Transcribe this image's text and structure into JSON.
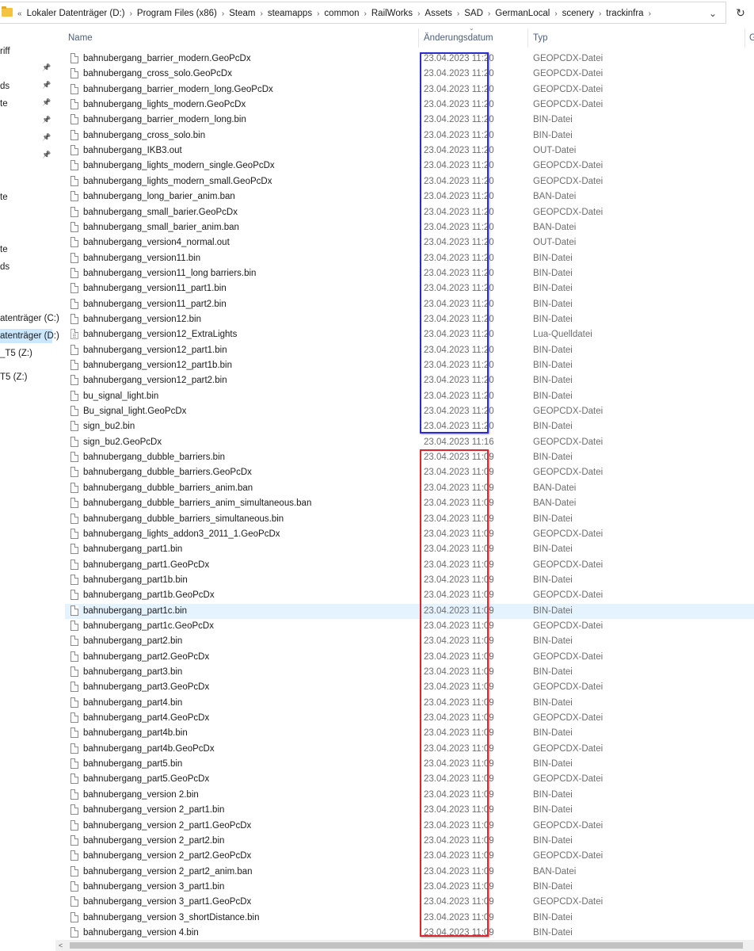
{
  "address": {
    "crumbs": [
      "Lokaler Datenträger (D:)",
      "Program Files (x86)",
      "Steam",
      "steamapps",
      "common",
      "RailWorks",
      "Assets",
      "SAD",
      "GermanLocal",
      "scenery",
      "trackinfra"
    ],
    "prefix": "«"
  },
  "nav": {
    "items": [
      "riff",
      "ds",
      "te",
      "te",
      "te",
      "ds",
      "atenträger (C:)",
      "atenträger (D:)",
      "_T5 (Z:)",
      "T5 (Z:)"
    ]
  },
  "columns": {
    "name": "Name",
    "date": "Änderungsdatum",
    "type": "Typ",
    "extra": "G"
  },
  "files": [
    {
      "name": "bahnubergang_barrier_modern.GeoPcDx",
      "date": "23.04.2023 11:20",
      "type": "GEOPCDX-Datei"
    },
    {
      "name": "bahnubergang_cross_solo.GeoPcDx",
      "date": "23.04.2023 11:20",
      "type": "GEOPCDX-Datei"
    },
    {
      "name": "bahnubergang_barrier_modern_long.GeoPcDx",
      "date": "23.04.2023 11:20",
      "type": "GEOPCDX-Datei"
    },
    {
      "name": "bahnubergang_lights_modern.GeoPcDx",
      "date": "23.04.2023 11:20",
      "type": "GEOPCDX-Datei"
    },
    {
      "name": "bahnubergang_barrier_modern_long.bin",
      "date": "23.04.2023 11:20",
      "type": "BIN-Datei"
    },
    {
      "name": "bahnubergang_cross_solo.bin",
      "date": "23.04.2023 11:20",
      "type": "BIN-Datei"
    },
    {
      "name": "bahnubergang_IKB3.out",
      "date": "23.04.2023 11:20",
      "type": "OUT-Datei"
    },
    {
      "name": "bahnubergang_lights_modern_single.GeoPcDx",
      "date": "23.04.2023 11:20",
      "type": "GEOPCDX-Datei"
    },
    {
      "name": "bahnubergang_lights_modern_small.GeoPcDx",
      "date": "23.04.2023 11:20",
      "type": "GEOPCDX-Datei"
    },
    {
      "name": "bahnubergang_long_barier_anim.ban",
      "date": "23.04.2023 11:20",
      "type": "BAN-Datei"
    },
    {
      "name": "bahnubergang_small_barier.GeoPcDx",
      "date": "23.04.2023 11:20",
      "type": "GEOPCDX-Datei"
    },
    {
      "name": "bahnubergang_small_barier_anim.ban",
      "date": "23.04.2023 11:20",
      "type": "BAN-Datei"
    },
    {
      "name": "bahnubergang_version4_normal.out",
      "date": "23.04.2023 11:20",
      "type": "OUT-Datei"
    },
    {
      "name": "bahnubergang_version11.bin",
      "date": "23.04.2023 11:20",
      "type": "BIN-Datei"
    },
    {
      "name": "bahnubergang_version11_long barriers.bin",
      "date": "23.04.2023 11:20",
      "type": "BIN-Datei"
    },
    {
      "name": "bahnubergang_version11_part1.bin",
      "date": "23.04.2023 11:20",
      "type": "BIN-Datei"
    },
    {
      "name": "bahnubergang_version11_part2.bin",
      "date": "23.04.2023 11:20",
      "type": "BIN-Datei"
    },
    {
      "name": "bahnubergang_version12.bin",
      "date": "23.04.2023 11:20",
      "type": "BIN-Datei"
    },
    {
      "name": "bahnubergang_version12_ExtraLights",
      "date": "23.04.2023 11:20",
      "type": "Lua-Quelldatei",
      "icon": "lua"
    },
    {
      "name": "bahnubergang_version12_part1.bin",
      "date": "23.04.2023 11:20",
      "type": "BIN-Datei"
    },
    {
      "name": "bahnubergang_version12_part1b.bin",
      "date": "23.04.2023 11:20",
      "type": "BIN-Datei"
    },
    {
      "name": "bahnubergang_version12_part2.bin",
      "date": "23.04.2023 11:20",
      "type": "BIN-Datei"
    },
    {
      "name": "bu_signal_light.bin",
      "date": "23.04.2023 11:20",
      "type": "BIN-Datei"
    },
    {
      "name": "Bu_signal_light.GeoPcDx",
      "date": "23.04.2023 11:20",
      "type": "GEOPCDX-Datei"
    },
    {
      "name": "sign_bu2.bin",
      "date": "23.04.2023 11:20",
      "type": "BIN-Datei"
    },
    {
      "name": "sign_bu2.GeoPcDx",
      "date": "23.04.2023 11:16",
      "type": "GEOPCDX-Datei"
    },
    {
      "name": "bahnubergang_dubble_barriers.bin",
      "date": "23.04.2023 11:09",
      "type": "BIN-Datei"
    },
    {
      "name": "bahnubergang_dubble_barriers.GeoPcDx",
      "date": "23.04.2023 11:09",
      "type": "GEOPCDX-Datei"
    },
    {
      "name": "bahnubergang_dubble_barriers_anim.ban",
      "date": "23.04.2023 11:09",
      "type": "BAN-Datei"
    },
    {
      "name": "bahnubergang_dubble_barriers_anim_simultaneous.ban",
      "date": "23.04.2023 11:09",
      "type": "BAN-Datei"
    },
    {
      "name": "bahnubergang_dubble_barriers_simultaneous.bin",
      "date": "23.04.2023 11:09",
      "type": "BIN-Datei"
    },
    {
      "name": "bahnubergang_lights_addon3_2011_1.GeoPcDx",
      "date": "23.04.2023 11:09",
      "type": "GEOPCDX-Datei"
    },
    {
      "name": "bahnubergang_part1.bin",
      "date": "23.04.2023 11:09",
      "type": "BIN-Datei"
    },
    {
      "name": "bahnubergang_part1.GeoPcDx",
      "date": "23.04.2023 11:09",
      "type": "GEOPCDX-Datei"
    },
    {
      "name": "bahnubergang_part1b.bin",
      "date": "23.04.2023 11:09",
      "type": "BIN-Datei"
    },
    {
      "name": "bahnubergang_part1b.GeoPcDx",
      "date": "23.04.2023 11:09",
      "type": "GEOPCDX-Datei"
    },
    {
      "name": "bahnubergang_part1c.bin",
      "date": "23.04.2023 11:09",
      "type": "BIN-Datei",
      "hover": true
    },
    {
      "name": "bahnubergang_part1c.GeoPcDx",
      "date": "23.04.2023 11:09",
      "type": "GEOPCDX-Datei"
    },
    {
      "name": "bahnubergang_part2.bin",
      "date": "23.04.2023 11:09",
      "type": "BIN-Datei"
    },
    {
      "name": "bahnubergang_part2.GeoPcDx",
      "date": "23.04.2023 11:09",
      "type": "GEOPCDX-Datei"
    },
    {
      "name": "bahnubergang_part3.bin",
      "date": "23.04.2023 11:09",
      "type": "BIN-Datei"
    },
    {
      "name": "bahnubergang_part3.GeoPcDx",
      "date": "23.04.2023 11:09",
      "type": "GEOPCDX-Datei"
    },
    {
      "name": "bahnubergang_part4.bin",
      "date": "23.04.2023 11:09",
      "type": "BIN-Datei"
    },
    {
      "name": "bahnubergang_part4.GeoPcDx",
      "date": "23.04.2023 11:09",
      "type": "GEOPCDX-Datei"
    },
    {
      "name": "bahnubergang_part4b.bin",
      "date": "23.04.2023 11:09",
      "type": "BIN-Datei"
    },
    {
      "name": "bahnubergang_part4b.GeoPcDx",
      "date": "23.04.2023 11:09",
      "type": "GEOPCDX-Datei"
    },
    {
      "name": "bahnubergang_part5.bin",
      "date": "23.04.2023 11:09",
      "type": "BIN-Datei"
    },
    {
      "name": "bahnubergang_part5.GeoPcDx",
      "date": "23.04.2023 11:09",
      "type": "GEOPCDX-Datei"
    },
    {
      "name": "bahnubergang_version 2.bin",
      "date": "23.04.2023 11:09",
      "type": "BIN-Datei"
    },
    {
      "name": "bahnubergang_version 2_part1.bin",
      "date": "23.04.2023 11:09",
      "type": "BIN-Datei"
    },
    {
      "name": "bahnubergang_version 2_part1.GeoPcDx",
      "date": "23.04.2023 11:09",
      "type": "GEOPCDX-Datei"
    },
    {
      "name": "bahnubergang_version 2_part2.bin",
      "date": "23.04.2023 11:09",
      "type": "BIN-Datei"
    },
    {
      "name": "bahnubergang_version 2_part2.GeoPcDx",
      "date": "23.04.2023 11:09",
      "type": "GEOPCDX-Datei"
    },
    {
      "name": "bahnubergang_version 2_part2_anim.ban",
      "date": "23.04.2023 11:09",
      "type": "BAN-Datei"
    },
    {
      "name": "bahnubergang_version 3_part1.bin",
      "date": "23.04.2023 11:09",
      "type": "BIN-Datei"
    },
    {
      "name": "bahnubergang_version 3_part1.GeoPcDx",
      "date": "23.04.2023 11:09",
      "type": "GEOPCDX-Datei"
    },
    {
      "name": "bahnubergang_version 3_shortDistance.bin",
      "date": "23.04.2023 11:09",
      "type": "BIN-Datei"
    },
    {
      "name": "bahnubergang_version 4.bin",
      "date": "23.04.2023 11:09",
      "type": "BIN-Datei"
    }
  ],
  "colors": {
    "highlight_blue": "#2a2bd0",
    "highlight_red": "#e0262d",
    "hover_row": "#e5f3ff",
    "selected_nav": "#cce8ff"
  }
}
